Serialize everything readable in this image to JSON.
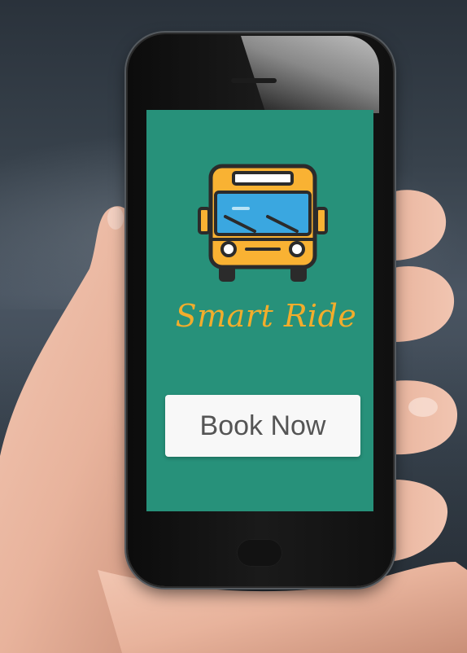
{
  "app": {
    "title": "Smart Ride",
    "icon": "bus-icon"
  },
  "actions": {
    "book_label": "Book Now"
  },
  "colors": {
    "screen_background": "#27917a",
    "title_text": "#f2ad2c",
    "button_background": "#f8f8f8",
    "button_text": "#555555",
    "bus_body": "#f9b233",
    "bus_window": "#3aa7e0"
  }
}
